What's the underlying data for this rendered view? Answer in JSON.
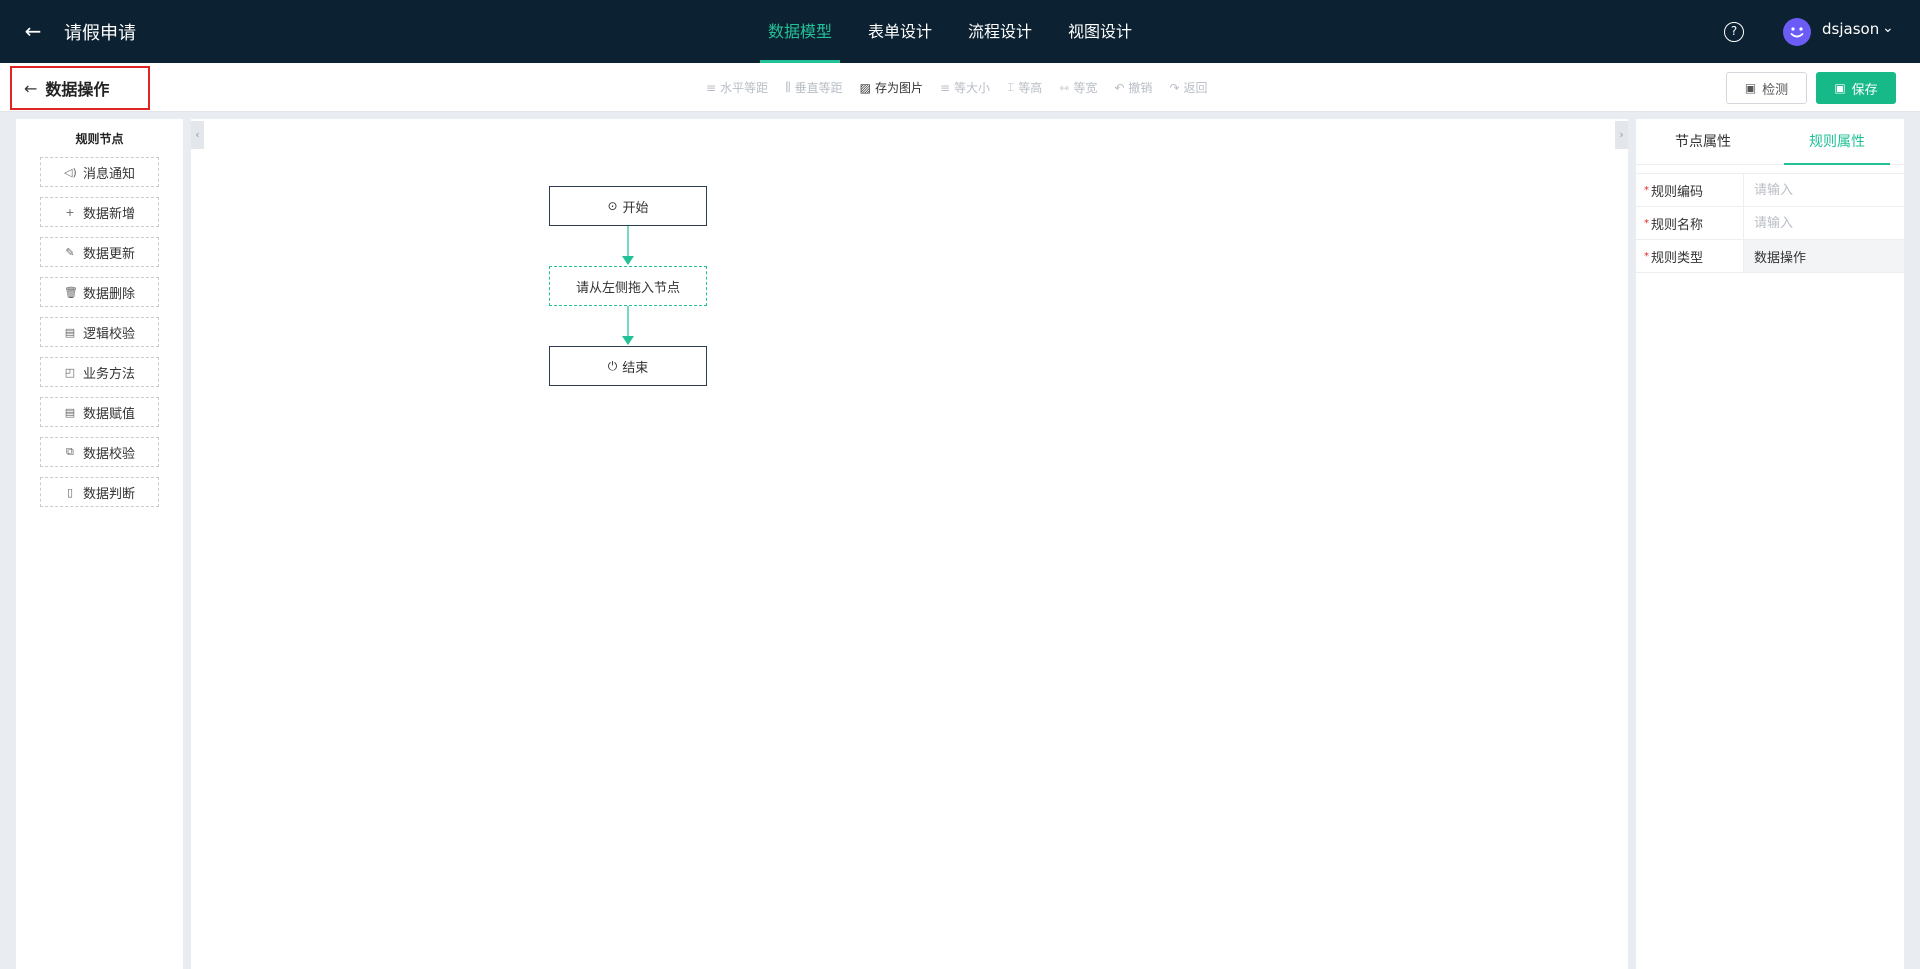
{
  "header": {
    "title": "请假申请",
    "tabs": [
      {
        "label": "数据模型",
        "active": true
      },
      {
        "label": "表单设计"
      },
      {
        "label": "流程设计"
      },
      {
        "label": "视图设计"
      }
    ],
    "help_icon": "?",
    "username": "dsjason"
  },
  "subbar": {
    "breadcrumb": "数据操作",
    "tools": [
      {
        "label": "水平等距",
        "icon": "≡",
        "enabled": false
      },
      {
        "label": "垂直等距",
        "icon": "⫼",
        "enabled": false
      },
      {
        "label": "存为图片",
        "icon": "▨",
        "enabled": true
      },
      {
        "label": "等大小",
        "icon": "≡",
        "enabled": false
      },
      {
        "label": "等高",
        "icon": "⌶",
        "enabled": false
      },
      {
        "label": "等宽",
        "icon": "⇿",
        "enabled": false
      },
      {
        "label": "撤销",
        "icon": "↶",
        "enabled": false
      },
      {
        "label": "返回",
        "icon": "↷",
        "enabled": false
      }
    ],
    "check_label": "检测",
    "save_label": "保存"
  },
  "palette": {
    "title": "规则节点",
    "items": [
      {
        "label": "消息通知",
        "icon": "◁)"
      },
      {
        "label": "数据新增",
        "icon": "+"
      },
      {
        "label": "数据更新",
        "icon": "✎"
      },
      {
        "label": "数据删除",
        "icon": "🗑"
      },
      {
        "label": "逻辑校验",
        "icon": "▤"
      },
      {
        "label": "业务方法",
        "icon": "◰"
      },
      {
        "label": "数据赋值",
        "icon": "▤"
      },
      {
        "label": "数据校验",
        "icon": "⧉"
      },
      {
        "label": "数据判断",
        "icon": "▯"
      }
    ]
  },
  "canvas": {
    "start_label": "开始",
    "placeholder_label": "请从左侧拖入节点",
    "end_label": "结束",
    "accent": "#22c197"
  },
  "props": {
    "tabs": [
      {
        "label": "节点属性"
      },
      {
        "label": "规则属性",
        "active": true
      }
    ],
    "fields": [
      {
        "label": "规则编码",
        "placeholder": "请输入",
        "value": ""
      },
      {
        "label": "规则名称",
        "placeholder": "请输入",
        "value": ""
      },
      {
        "label": "规则类型",
        "value": "数据操作",
        "readonly": true
      }
    ]
  }
}
